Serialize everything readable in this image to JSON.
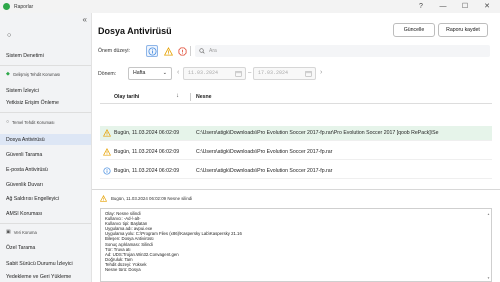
{
  "window": {
    "title": "Raporlar",
    "help": "?",
    "minimize": "—",
    "maximize": "☐",
    "close": "✕"
  },
  "sidebar": {
    "collapse": "«",
    "groups": [
      {
        "ring": true,
        "items": [
          "Sistem Denetimi"
        ]
      },
      {
        "header": "Gelişmiş Tehdit Koruması",
        "items": [
          "Sistem İzleyici",
          "Yetkisiz Erişim Önleme"
        ]
      },
      {
        "header": "Temel Tehdit Koruması",
        "items": [
          "Dosya Antivirüsü",
          "Güvenli Tarama",
          "E-posta Antivirüsü",
          "Güvenlik Duvarı",
          "Ağ Saldırısı Engelleyici",
          "AMSI Koruması"
        ]
      },
      {
        "header": "Veri Koruma",
        "items": [
          "Özel Tarama",
          "Sabit Sürücü Durumu İzleyici",
          "Yedekleme ve Geri Yükleme"
        ]
      }
    ]
  },
  "main": {
    "title": "Dosya Antivirüsü",
    "refresh_label": "Güncelle",
    "save_label": "Raporu kaydet",
    "importance_label": "Önem düzeyi:",
    "search_placeholder": "Ara",
    "period_label": "Dönem:",
    "period_value": "Hafta",
    "date_from": "11.03.2024",
    "date_to": "17.03.2024",
    "columns": {
      "date": "Olay tarihi",
      "name": "Nesne"
    },
    "rows": [
      {
        "level": "warning",
        "date": "Bugün, 11.03.2024 06:02:09",
        "name": "C:\\Users\\atigk\\Downloads\\Pro Evolution Soccer 2017-fp.rar\\Pro Evolution Soccer 2017 [qoob RePack]\\Se",
        "selected": true
      },
      {
        "level": "warning",
        "date": "Bugün, 11.03.2024 06:02:09",
        "name": "C:\\Users\\atigk\\Downloads\\Pro Evolution Soccer 2017-fp.rar",
        "selected": false
      },
      {
        "level": "info",
        "date": "Bugün, 11.03.2024 06:02:09",
        "name": "C:\\Users\\atigk\\Downloads\\Pro Evolution Soccer 2017-fp.rar",
        "selected": false
      }
    ],
    "detail_header": "Bugün, 11.03.2024 06:02:09 Nesne silindi",
    "detail_lines": [
      "Olay: Nesne silindi",
      "Kullanıcı: -Ad-\\-alt-",
      "Kullanıcı tipi: Başlatan",
      "Uygulama adı: avpui.exe",
      "Uygulama yolu: C:\\Program Files (x86)\\Kaspersky Lab\\Kaspersky 21.16",
      "Bileşen: Dosya Antivirüsü",
      "Sonuç açıklaması: Silindi",
      "Tür: Truva atı",
      "Ad: UDS:Trojan.Win32.Convagent.gen",
      "Doğruluk: Tam",
      "Tehdit düzeyi: Yüksek",
      "Nesne türü: Dosya"
    ]
  }
}
